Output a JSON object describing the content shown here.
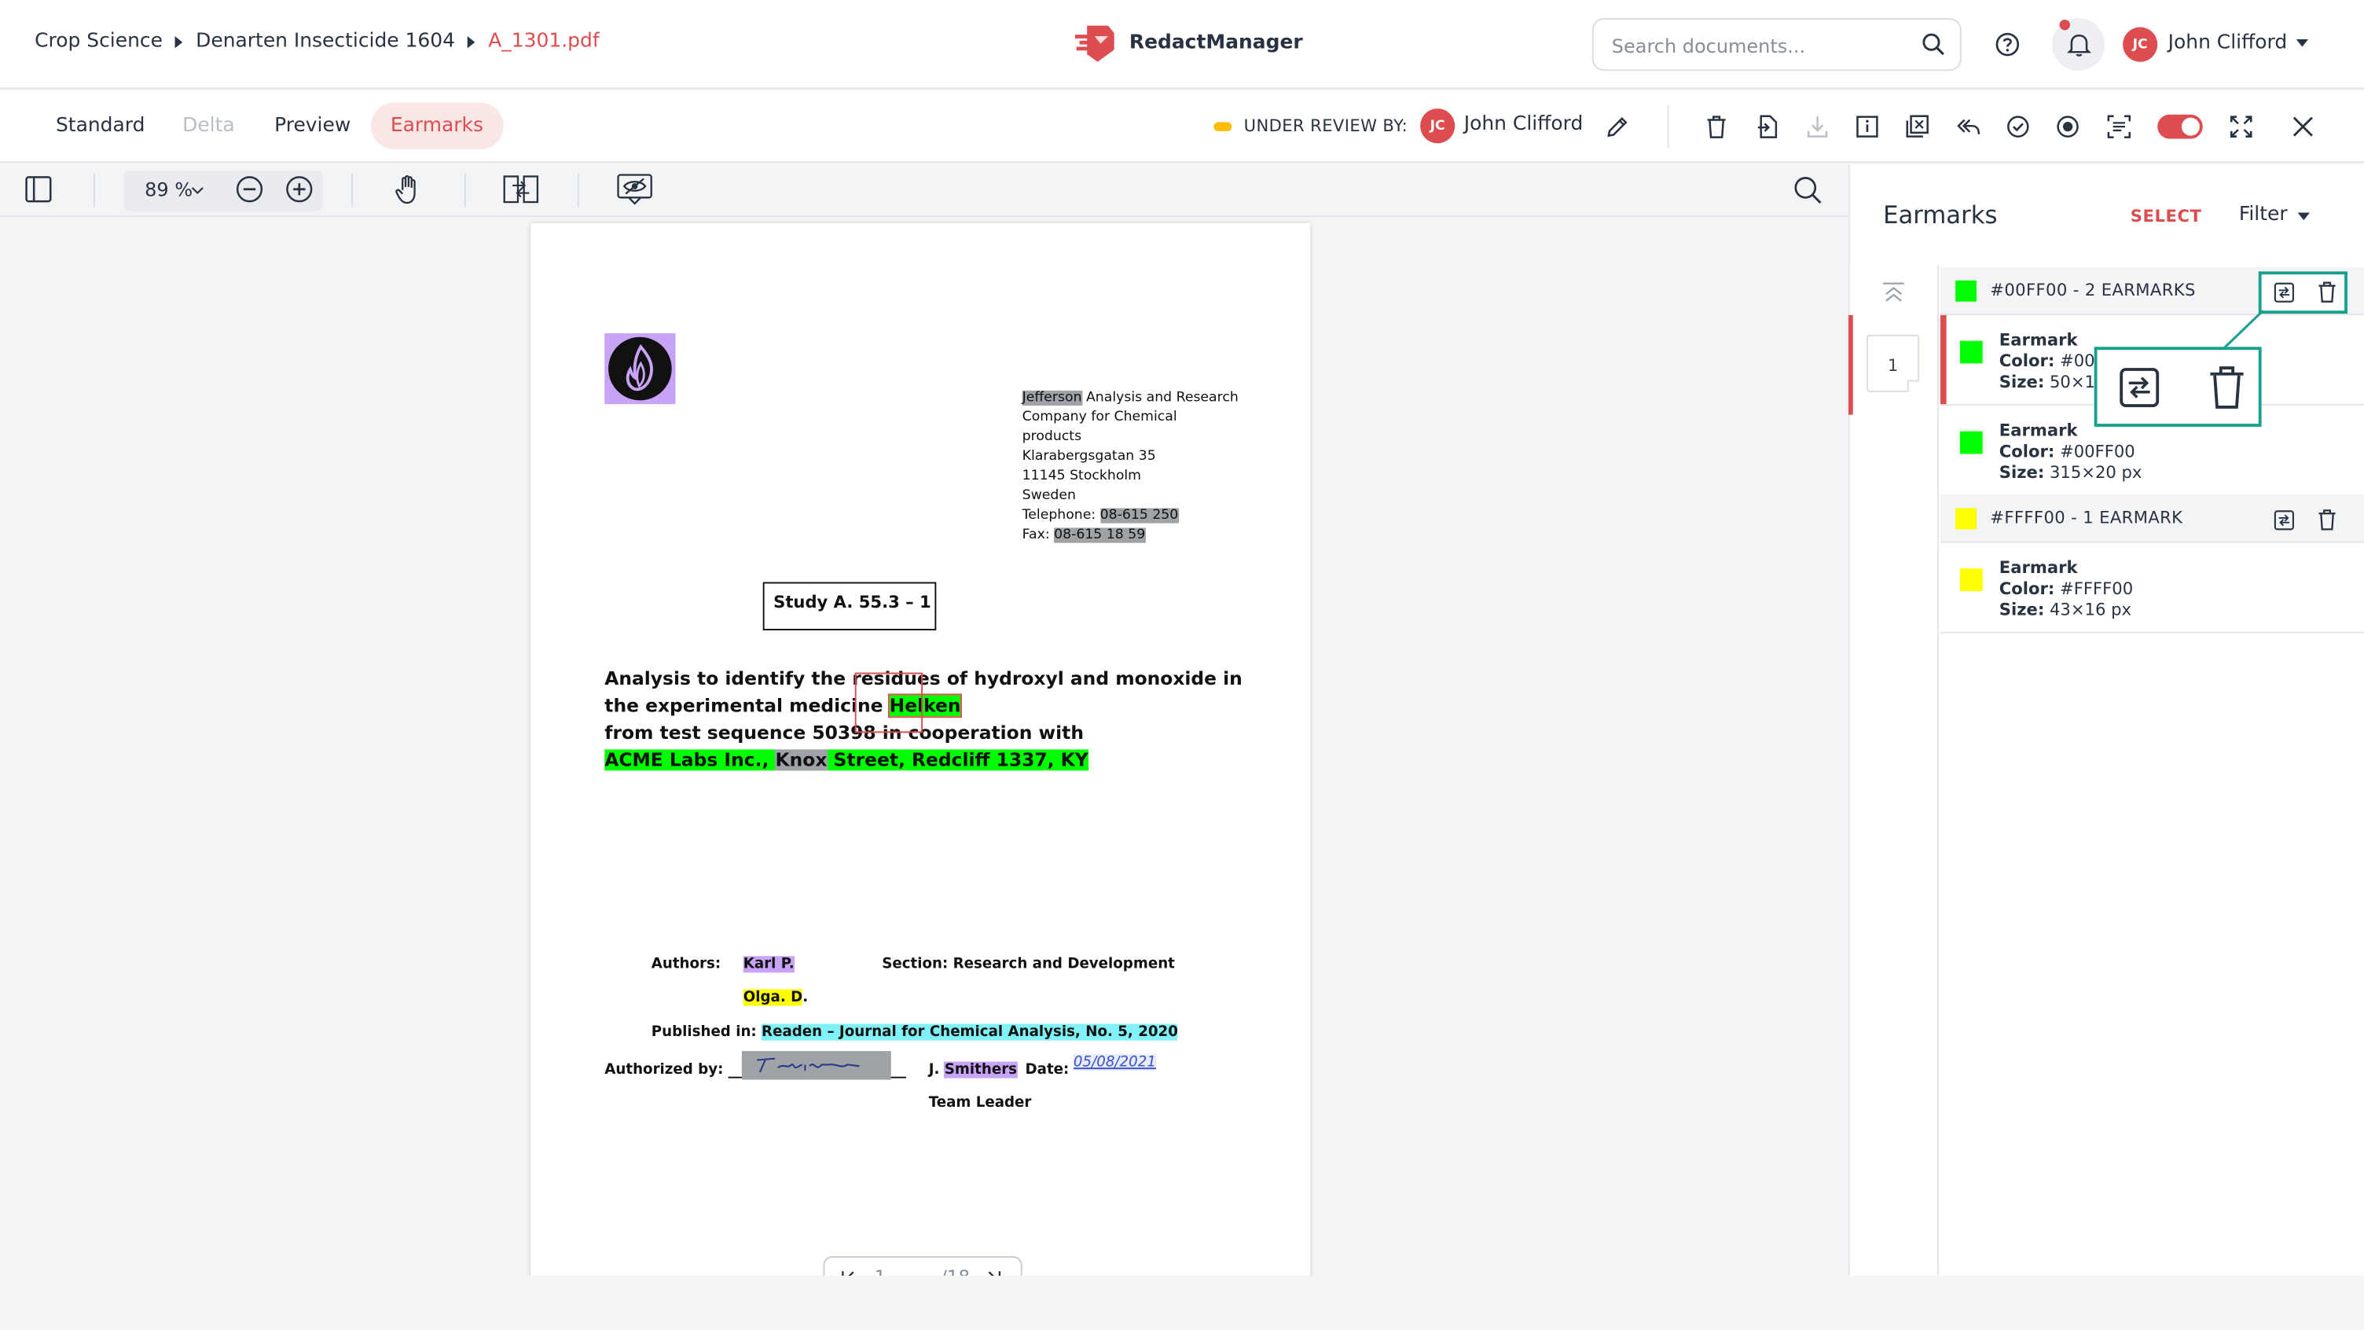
{
  "header": {
    "breadcrumb": [
      "Crop Science",
      "Denarten Insecticide 1604",
      "A_1301.pdf"
    ],
    "brand_name": "RedactManager",
    "search_placeholder": "Search documents...",
    "user_initials": "JC",
    "user_name": "John Clifford"
  },
  "view_tabs": [
    "Standard",
    "Delta",
    "Preview",
    "Earmarks"
  ],
  "active_view": "Earmarks",
  "review": {
    "label": "UNDER REVIEW BY:",
    "initials": "JC",
    "reviewer": "John Clifford"
  },
  "viewer": {
    "zoom": "89",
    "zoom_unit": "%",
    "current_page": "1",
    "total_pages": "/18"
  },
  "document": {
    "address_lines": [
      "Jefferson Analysis and Research",
      "Company for Chemical",
      "products",
      "Klarabergsgatan 35",
      "11145 Stockholm",
      "Sweden"
    ],
    "address_highlight": "Jefferson",
    "address_rest": " Analysis and Research",
    "telephone_label": "Telephone: ",
    "telephone": "08-615 250",
    "fax_label": "Fax: ",
    "fax": "08-615 18 59",
    "study_label": "Study A. 55.3 – 1",
    "title_line1": "Analysis to identify the residues of hydroxyl and monoxide in",
    "title_line2_prefix": "the experimental medicine ",
    "title_line2_highlight": "Helken",
    "title_line3": "from test sequence 50398 in cooperation with",
    "title_line4_a": "ACME Labs Inc., ",
    "title_line4_b": "Knox",
    "title_line4_c": " Street, Redcliff 1337, KY",
    "authors_label": "Authors:",
    "author1": "Karl P.",
    "author2": "Olga. D",
    "author2_suffix": ".",
    "section": "Section: Research and Development",
    "published_label": "Published in: ",
    "published": "Readen – Journal for Chemical Analysis, No. 5, 2020",
    "authorized_label": "Authorized by:",
    "smithers_prefix": "J. ",
    "smithers": "Smithers",
    "date_label": "Date:",
    "date_value": "05/08/2021",
    "team_leader": "Team Leader"
  },
  "panel": {
    "title": "Earmarks",
    "select_label": "SELECT",
    "filter_label": "Filter",
    "page_number": "1",
    "groups": [
      {
        "label": "#00FF00 - 2 EARMARKS",
        "color": "#00ff00",
        "items": [
          {
            "title": "Earmark",
            "color_label": "Color:",
            "color_value": " #00FF00",
            "size_label": "Size:",
            "size_value": " 50×19"
          },
          {
            "title": "Earmark",
            "color_label": "Color:",
            "color_value": " #00FF00",
            "size_label": "Size:",
            "size_value": " 315×20 px"
          }
        ]
      },
      {
        "label": "#FFFF00 - 1 EARMARK",
        "color": "#ffff00",
        "items": [
          {
            "title": "Earmark",
            "color_label": "Color:",
            "color_value": " #FFFF00",
            "size_label": "Size:",
            "size_value": " 43×16 px"
          }
        ]
      }
    ]
  },
  "colors": {
    "accent": "#dd4d50",
    "callout": "#17a08e",
    "review_dot": "#fdbd00"
  }
}
